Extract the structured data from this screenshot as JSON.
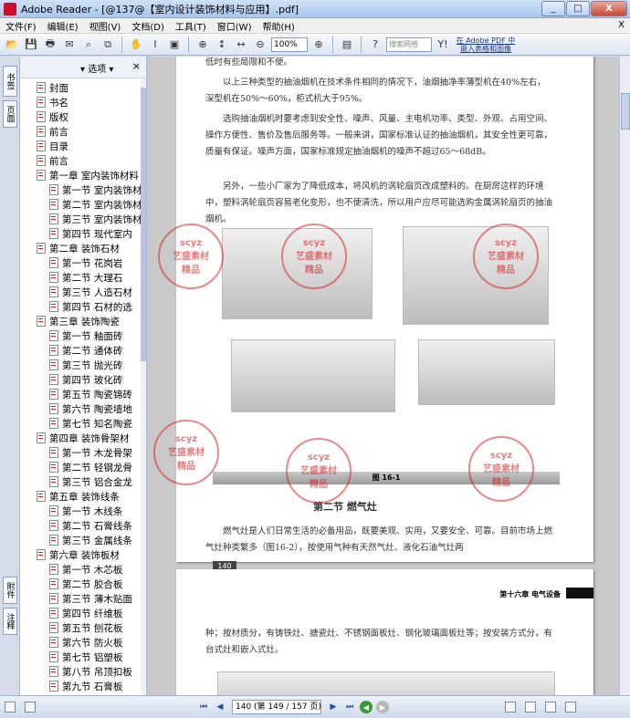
{
  "window": {
    "title": "Adobe Reader - [@137@【室内设计装饰材料与应用】.pdf]",
    "buttons": [
      "_",
      "□",
      "X"
    ]
  },
  "menu": {
    "items": [
      "文件(F)",
      "编辑(E)",
      "视图(V)",
      "文档(D)",
      "工具(T)",
      "窗口(W)",
      "帮助(H)"
    ],
    "close": "X"
  },
  "toolbar": {
    "zoom": "100%",
    "search_placeholder": "搜索网络",
    "ad_text": "在 Adobe PDF 中嵌入表格和图像"
  },
  "navtabs": {
    "bookmarks": "书签",
    "pages": "页面",
    "attachments": "附件",
    "comments": "注释"
  },
  "bookmarks": {
    "options_label": "选项",
    "items": [
      {
        "label": "封面",
        "level": 1
      },
      {
        "label": "书名",
        "level": 1
      },
      {
        "label": "版权",
        "level": 1
      },
      {
        "label": "前言",
        "level": 1
      },
      {
        "label": "目录",
        "level": 1
      },
      {
        "label": "前言",
        "level": 1
      },
      {
        "label": "第一章 室内装饰材料",
        "level": 1
      },
      {
        "label": "第一节 室内装饰材",
        "level": 2
      },
      {
        "label": "第二节 室内装饰材",
        "level": 2
      },
      {
        "label": "第三节 室内装饰材",
        "level": 2
      },
      {
        "label": "第四节 现代室内",
        "level": 2
      },
      {
        "label": "第二章 装饰石材",
        "level": 1
      },
      {
        "label": "第一节 花岗岩",
        "level": 2
      },
      {
        "label": "第二节 大理石",
        "level": 2
      },
      {
        "label": "第三节 人造石材",
        "level": 2
      },
      {
        "label": "第四节 石材的选",
        "level": 2
      },
      {
        "label": "第三章 装饰陶瓷",
        "level": 1
      },
      {
        "label": "第一节 釉面砖",
        "level": 2
      },
      {
        "label": "第二节 通体砖",
        "level": 2
      },
      {
        "label": "第三节 抛光砖",
        "level": 2
      },
      {
        "label": "第四节 玻化砖",
        "level": 2
      },
      {
        "label": "第五节 陶瓷锦砖",
        "level": 2
      },
      {
        "label": "第六节 陶瓷墙地",
        "level": 2
      },
      {
        "label": "第七节 知名陶瓷",
        "level": 2
      },
      {
        "label": "第四章 装饰骨架材",
        "level": 1
      },
      {
        "label": "第一节 木龙骨架",
        "level": 2
      },
      {
        "label": "第二节 轻钢龙骨",
        "level": 2
      },
      {
        "label": "第三节 铝合金龙",
        "level": 2
      },
      {
        "label": "第五章 装饰线条",
        "level": 1
      },
      {
        "label": "第一节 木线条",
        "level": 2
      },
      {
        "label": "第二节 石膏线条",
        "level": 2
      },
      {
        "label": "第三节 金属线条",
        "level": 2
      },
      {
        "label": "第六章 装饰板材",
        "level": 1
      },
      {
        "label": "第一节 木芯板",
        "level": 2
      },
      {
        "label": "第二节 胶合板",
        "level": 2
      },
      {
        "label": "第三节 薄木贴面",
        "level": 2
      },
      {
        "label": "第四节 纤维板",
        "level": 2
      },
      {
        "label": "第五节 刨花板",
        "level": 2
      },
      {
        "label": "第六节 防火板",
        "level": 2
      },
      {
        "label": "第七节 铝塑板",
        "level": 2
      },
      {
        "label": "第八节 吊顶扣板",
        "level": 2
      },
      {
        "label": "第九节 石膏板",
        "level": 2
      }
    ]
  },
  "document": {
    "para1": "低时有些局限和不便。",
    "para2": "以上三种类型的抽油烟机在技术条件相同的情况下，油烟抽净率薄型机在40%左右，深型机在50%～60%，柜式机大于95%。",
    "para3": "选购抽油烟机时要考虑到安全性、噪声、风量、主电机功率、类型、外观、占用空间、操作方便性、售价及售后服务等。一般来讲，国家标准认证的抽油烟机，其安全性更可靠，质量有保证。噪声方面，国家标准规定抽油烟机的噪声不超过65～68dB。",
    "para4": "另外，一些小厂家为了降低成本，将风机的涡轮扇页改成塑料的。在厨房这样的环境中，塑料涡轮扇页容易老化变形，也不便清洗，所以用户应尽可能选购金属涡轮扇页的抽油烟机。",
    "figure_caption": "图 16-1",
    "section_title": "第二节 燃气灶",
    "para5": "燃气灶是人们日常生活的必备用品，既要美观、实用，又要安全、可靠。目前市场上燃气灶种类繁多（图16-2），按使用气种有天然气灶、液化石油气灶两",
    "page_badge": "140",
    "chapter_header": "第十六章 电气设备",
    "page2_text": "种；按材质分，有铸铁灶、搪瓷灶、不锈钢面板灶、钢化玻璃面板灶等；按安装方式分，有台式灶和嵌入式灶。",
    "watermark_texts": [
      "scyz",
      "艺盛素材",
      "精品"
    ]
  },
  "statusbar": {
    "page_display": "140 (第 149 / 157 页)"
  }
}
